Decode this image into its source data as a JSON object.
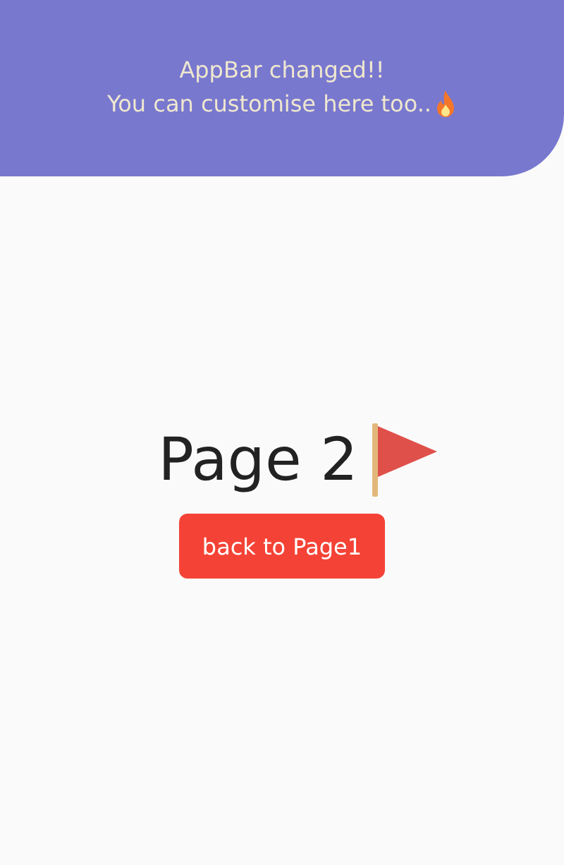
{
  "app_bar": {
    "title_lines": [
      "AppBar changed!!",
      "You can customise here too.."
    ]
  },
  "page": {
    "heading": "Page 2",
    "button": "back to Page1"
  }
}
